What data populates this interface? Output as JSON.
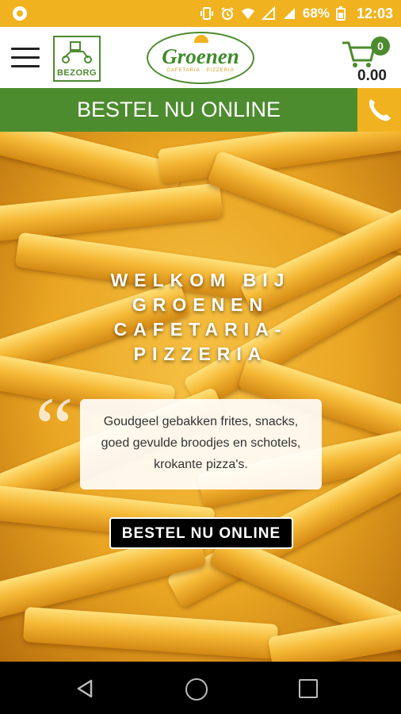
{
  "status_bar": {
    "battery_percent": "68%",
    "time": "12:03",
    "icons": [
      "notification-icon",
      "vibrate-icon",
      "alarm-icon",
      "wifi-icon",
      "signal-icon",
      "battery-icon"
    ]
  },
  "header": {
    "menu_icon": "hamburger-menu-icon",
    "delivery_badge": "BEZORG",
    "logo_name": "Groenen",
    "logo_sub": "CAFETARIA · PIZZERIA",
    "cart_count": "0",
    "cart_total": "0.00"
  },
  "order_bar": {
    "label": "BESTEL NU ONLINE",
    "phone_icon": "phone-icon"
  },
  "hero": {
    "title_lines": [
      "WELKOM BIJ",
      "GROENEN",
      "CAFETARIA-",
      "PIZZERIA"
    ],
    "quote_mark": "“",
    "tagline": "Goudgeel gebakken frites, snacks, goed gevulde broodjes en schotels, krokante pizza's.",
    "cta_label": "BESTEL NU ONLINE"
  },
  "colors": {
    "accent_yellow": "#f0b31f",
    "brand_green": "#4d8b2f"
  }
}
